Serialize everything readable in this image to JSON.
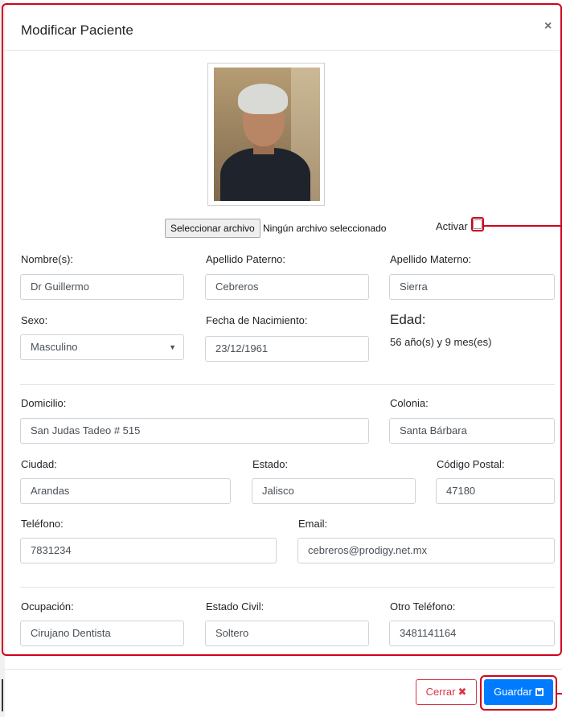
{
  "modal": {
    "title": "Modificar Paciente",
    "close_icon": "×"
  },
  "photo": {
    "alt": "patient-photo"
  },
  "file": {
    "button_label": "Seleccionar archivo",
    "status": "Ningún archivo seleccionado"
  },
  "activar": {
    "label": "Activar",
    "checked": false
  },
  "fields": {
    "nombre": {
      "label": "Nombre(s):",
      "value": "Dr Guillermo"
    },
    "apellido_paterno": {
      "label": "Apellido Paterno:",
      "value": "Cebreros"
    },
    "apellido_materno": {
      "label": "Apellido Materno:",
      "value": "Sierra"
    },
    "sexo": {
      "label": "Sexo:",
      "value": "Masculino",
      "caret": "▼"
    },
    "fecha_nacimiento": {
      "label": "Fecha de Nacimiento:",
      "value": "23/12/1961"
    },
    "edad": {
      "label": "Edad:",
      "value": "56 año(s) y 9 mes(es)"
    },
    "domicilio": {
      "label": "Domicilio:",
      "value": "San Judas Tadeo # 515"
    },
    "colonia": {
      "label": "Colonia:",
      "value": "Santa Bárbara"
    },
    "ciudad": {
      "label": "Ciudad:",
      "value": "Arandas"
    },
    "estado": {
      "label": "Estado:",
      "value": "Jalisco"
    },
    "codigo_postal": {
      "label": "Código Postal:",
      "value": "47180"
    },
    "telefono": {
      "label": "Teléfono:",
      "value": "7831234"
    },
    "email": {
      "label": "Email:",
      "value": "cebreros@prodigy.net.mx"
    },
    "ocupacion": {
      "label": "Ocupación:",
      "value": "Cirujano Dentista"
    },
    "estado_civil": {
      "label": "Estado Civil:",
      "value": "Soltero"
    },
    "otro_telefono": {
      "label": "Otro Teléfono:",
      "value": "3481141164"
    }
  },
  "footer": {
    "cerrar_label": "Cerrar",
    "cerrar_icon": "✖",
    "guardar_label": "Guardar"
  },
  "colors": {
    "primary": "#007bff",
    "danger": "#dc3545",
    "annotation": "#d0021b"
  }
}
